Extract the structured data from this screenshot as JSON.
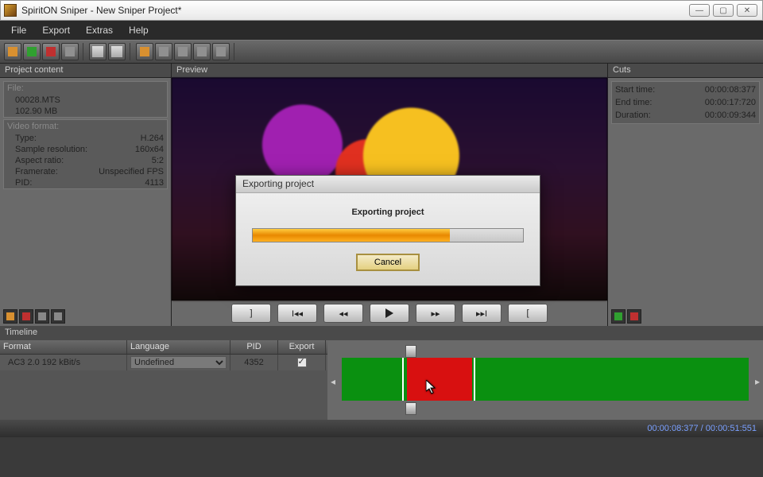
{
  "app": {
    "title": "SpiritON Sniper - New Sniper Project*"
  },
  "menu": {
    "file": "File",
    "export": "Export",
    "extras": "Extras",
    "help": "Help"
  },
  "panels": {
    "project": {
      "title": "Project content",
      "file_section": "File:",
      "filename": "00028.MTS",
      "filesize": "102.90 MB",
      "video_section": "Video format:",
      "type_label": "Type:",
      "type": "H.264",
      "res_label": "Sample resolution:",
      "res": "160x64",
      "aspect_label": "Aspect ratio:",
      "aspect": "5:2",
      "fps_label": "Framerate:",
      "fps": "Unspecified FPS",
      "pid_label": "PID:",
      "pid": "4113"
    },
    "preview": "Preview",
    "cuts": {
      "title": "Cuts",
      "start_label": "Start time:",
      "start": "00:00:08:377",
      "end_label": "End time:",
      "end": "00:00:17:720",
      "dur_label": "Duration:",
      "dur": "00:00:09:344"
    }
  },
  "timeline": {
    "title": "Timeline",
    "headers": {
      "format": "Format",
      "language": "Language",
      "pid": "PID",
      "export": "Export"
    },
    "row": {
      "format": "AC3 2.0 192 kBit/s",
      "language": "Undefined",
      "pid": "4352"
    }
  },
  "status": "00:00:08:377 / 00:00:51:551",
  "dialog": {
    "title": "Exporting project",
    "message": "Exporting project",
    "cancel": "Cancel"
  },
  "transport": {
    "prev_frame": "|◀◀",
    "rewind": "◀◀",
    "forward": "▶▶",
    "next_frame": "▶▶|"
  }
}
